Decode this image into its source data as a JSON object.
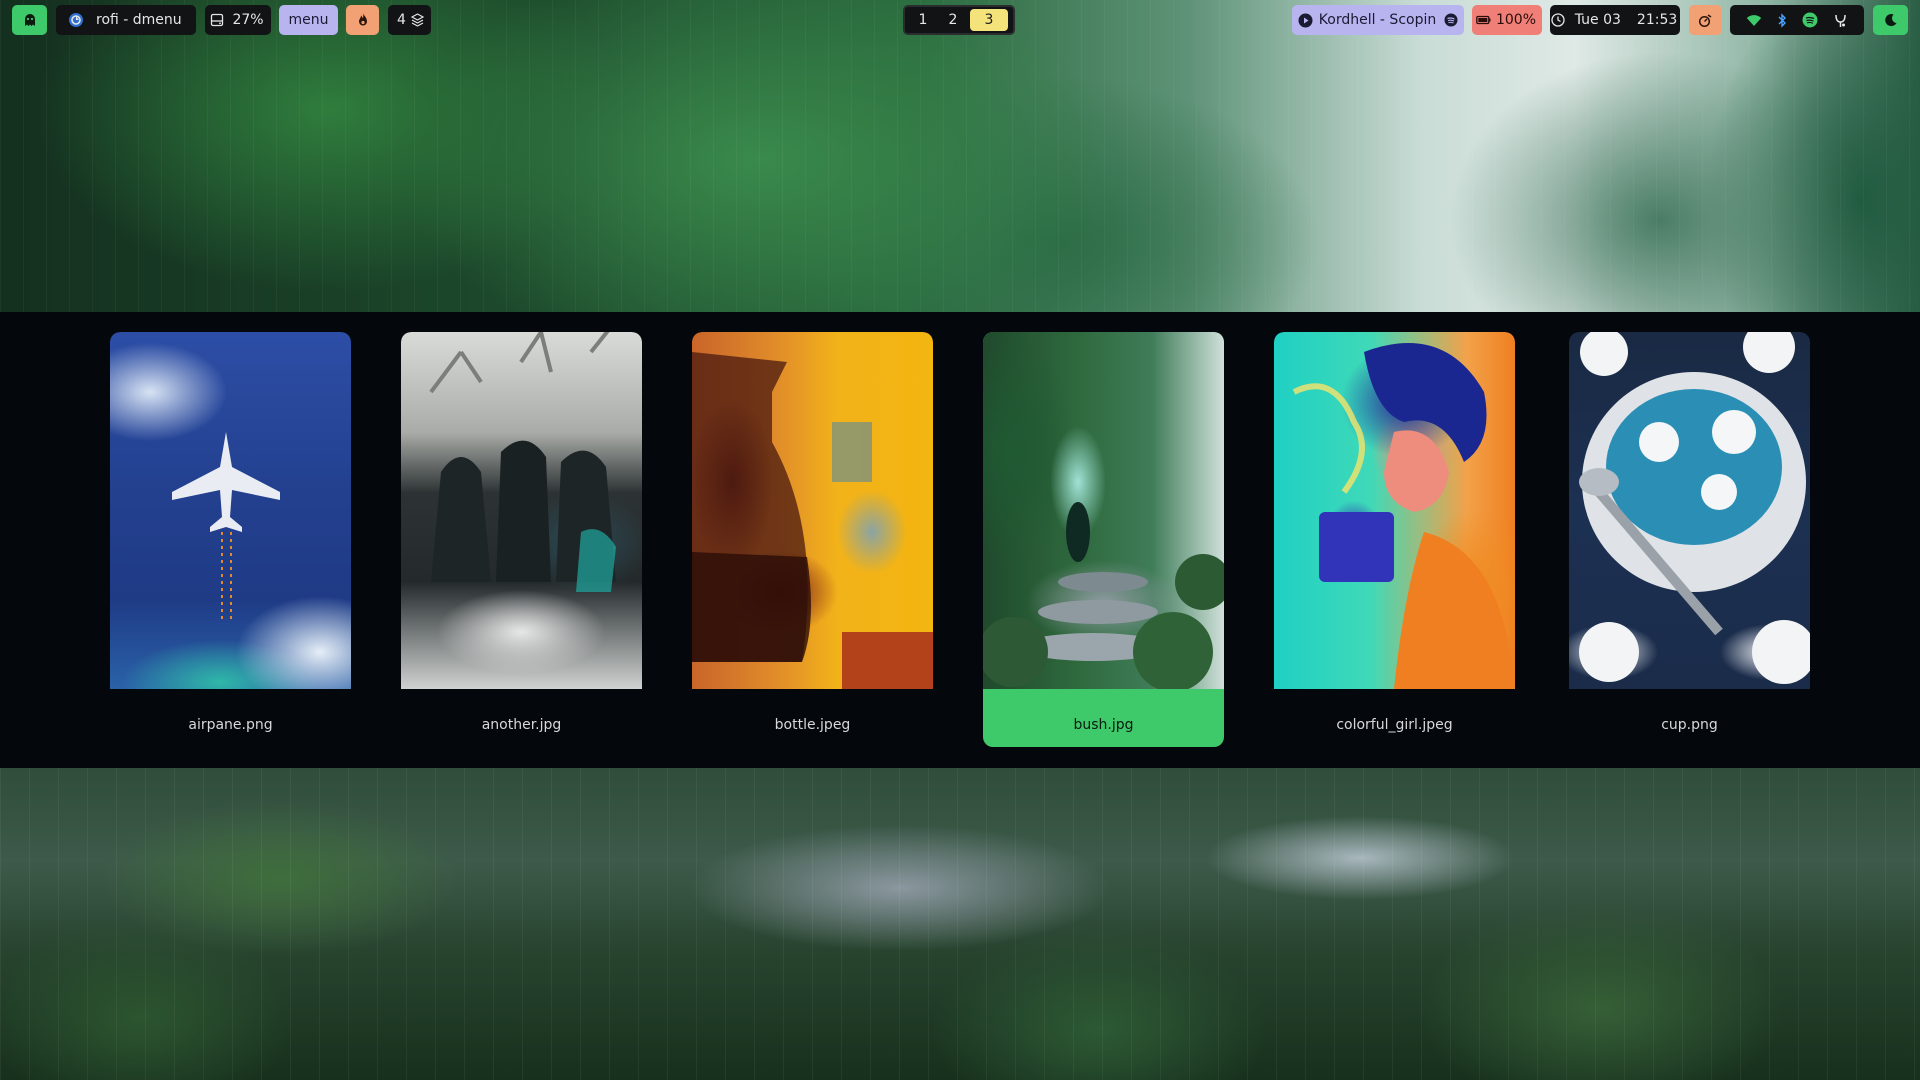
{
  "bar": {
    "window_title": "rofi - dmenu",
    "disk": "27%",
    "menu_label": "menu",
    "layers_count": "4",
    "workspaces": [
      "1",
      "2",
      "3"
    ],
    "active_workspace": "3",
    "media": "Kordhell - Scopin",
    "battery": "100%",
    "date": "Tue 03",
    "time": "21:53",
    "icons": {
      "launcher": "ghost-icon",
      "window": "app-icon",
      "disk": "disk-icon",
      "pomodoro": "flame-icon",
      "layers": "layers-icon",
      "play": "play-icon",
      "spotify": "spotify-icon",
      "battery": "battery-icon",
      "clock": "clock-icon",
      "timer": "timer-icon",
      "wifi": "wifi-icon",
      "bluetooth": "bluetooth-icon",
      "spotify_tray": "spotify-tray-icon",
      "tray_app": "app-tray-icon",
      "night_mode": "moon-icon"
    },
    "colors": {
      "green": "#3ec96a",
      "lavender": "#b8b4f0",
      "orange": "#f1a173",
      "red": "#f07f78",
      "yellow": "#f4e27a",
      "dark": "#111314"
    }
  },
  "rofi": {
    "selected_index": 3,
    "items": [
      {
        "label": "airpane.png"
      },
      {
        "label": "another.jpg"
      },
      {
        "label": "bottle.jpeg"
      },
      {
        "label": "bush.jpg"
      },
      {
        "label": "colorful_girl.jpeg"
      },
      {
        "label": "cup.png"
      }
    ]
  }
}
